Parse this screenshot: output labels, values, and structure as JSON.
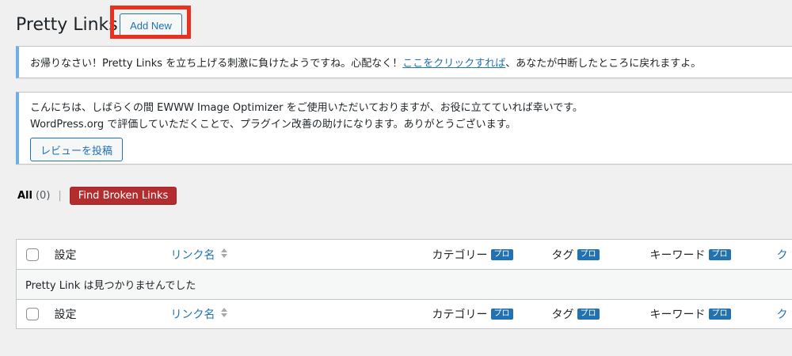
{
  "page": {
    "title": "Pretty Links",
    "add_new_label": "Add New"
  },
  "notice1": {
    "text_before": "お帰りなさい！Pretty Links を立ち上げる刺激に負けたようですね。心配なく！",
    "link_text": "ここをクリックすれば",
    "text_after": "、あなたが中断したところに戻れますよ。"
  },
  "notice2": {
    "line1": "こんにちは、しばらくの間 EWWW Image Optimizer をご使用いただいておりますが、お役に立てていれば幸いです。",
    "line2": "WordPress.org で評価していただくことで、プラグイン改善の助けになります。ありがとうございます。",
    "review_button": "レビューを投稿"
  },
  "filters": {
    "all_label": "All",
    "all_count": "(0)",
    "separator": "|",
    "broken_button": "Find Broken Links"
  },
  "table": {
    "columns": {
      "settings": "設定",
      "link_name": "リンク名",
      "category": "カテゴリー",
      "tag": "タグ",
      "keyword": "キーワード",
      "pro_badge": "プロ",
      "cut_off": "ク"
    },
    "empty_message": "Pretty Link は見つかりませんでした"
  },
  "colors": {
    "accent": "#2271b1",
    "danger": "#b32d2e",
    "highlight": "#e8321f",
    "notice_border": "#72aee6"
  }
}
